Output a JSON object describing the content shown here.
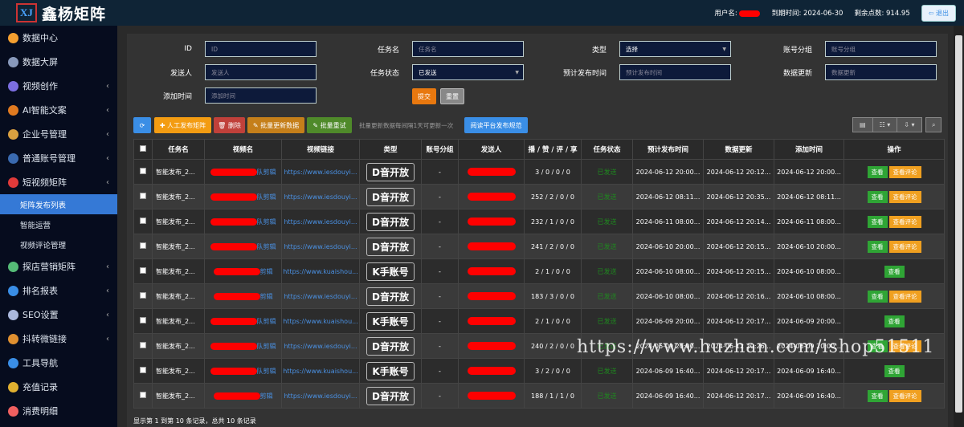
{
  "header": {
    "logo_mark": "XJ",
    "title": "鑫杨矩阵",
    "user_label": "用户名:",
    "expire": "到期时间: 2024-06-30",
    "points": "剩余点数: 914.95",
    "logout": "⇦ 退出"
  },
  "sidebar": {
    "items": [
      {
        "label": "数据中心",
        "color": "#f5a030",
        "chev": false
      },
      {
        "label": "数据大屏",
        "color": "#8899bb",
        "chev": false
      },
      {
        "label": "视频创作",
        "color": "#7b6ee0",
        "chev": true
      },
      {
        "label": "AI智能文案",
        "color": "#e07a20",
        "chev": true
      },
      {
        "label": "企业号管理",
        "color": "#d9a040",
        "chev": true
      },
      {
        "label": "普通账号管理",
        "color": "#3a6ab0",
        "chev": true
      },
      {
        "label": "短视频矩阵",
        "color": "#e03a3a",
        "chev": true
      }
    ],
    "sub": [
      "矩阵发布列表",
      "智能运营",
      "视频评论管理"
    ],
    "items2": [
      {
        "label": "探店营销矩阵",
        "color": "#55bb77",
        "chev": true
      },
      {
        "label": "排名报表",
        "color": "#3a8ee6",
        "chev": true
      },
      {
        "label": "SEO设置",
        "color": "#aab8dd",
        "chev": true
      },
      {
        "label": "抖转微链接",
        "color": "#e09030",
        "chev": true
      },
      {
        "label": "工具导航",
        "color": "#3a8ee6",
        "chev": false
      },
      {
        "label": "充值记录",
        "color": "#e0b030",
        "chev": false
      },
      {
        "label": "消费明细",
        "color": "#f06060",
        "chev": false
      }
    ]
  },
  "filters": {
    "id": {
      "label": "ID",
      "ph": "ID"
    },
    "task": {
      "label": "任务名",
      "ph": "任务名"
    },
    "type": {
      "label": "类型",
      "value": "选择"
    },
    "group": {
      "label": "账号分组",
      "ph": "账号分组"
    },
    "sender": {
      "label": "发送人",
      "ph": "发送人"
    },
    "status": {
      "label": "任务状态",
      "value": "已发送"
    },
    "plan": {
      "label": "预计发布时间",
      "ph": "预计发布时间"
    },
    "update": {
      "label": "数据更新",
      "ph": "数据更新"
    },
    "added": {
      "label": "添加时间",
      "ph": "添加时间"
    },
    "submit": "提交",
    "reset": "重置"
  },
  "toolbar": {
    "refresh": "⟳",
    "manual": "✚ 人工发布矩阵",
    "delete": "🗑 删除",
    "batch_update": "✎ 批量更新数据",
    "batch_retry": "✎ 批量重试",
    "note": "批量更新数据每间隔1天可更新一次",
    "rules": "阅读平台发布规范",
    "icons": [
      "▤",
      "☷ ▾",
      "⇩ ▾"
    ],
    "search": "⌕"
  },
  "table": {
    "headers": [
      "任务名",
      "视频名",
      "视频链接",
      "类型",
      "账号分组",
      "发送人",
      "播 / 赞 / 评 / 享",
      "任务状态",
      "预计发布时间",
      "数据更新",
      "添加时间",
      "操作"
    ],
    "view": "查看",
    "comments": "查看评论",
    "rows": [
      {
        "task": "智能发布_2...",
        "vname": "队剪辑",
        "link": "https://www.iesdouyi...",
        "type": "D音开放",
        "group": "-",
        "stats": "3 / 0 / 0 / 0",
        "status": "已发送",
        "plan": "2024-06-12 20:00...",
        "upd": "2024-06-12 20:12...",
        "add": "2024-06-12 20:00...",
        "cm": true
      },
      {
        "task": "智能发布_2...",
        "vname": "队剪辑",
        "link": "https://www.iesdouyi...",
        "type": "D音开放",
        "group": "-",
        "stats": "252 / 2 / 0 / 0",
        "status": "已发送",
        "plan": "2024-06-12 08:11...",
        "upd": "2024-06-12 20:35...",
        "add": "2024-06-12 08:11...",
        "cm": true
      },
      {
        "task": "智能发布_2...",
        "vname": "队剪辑",
        "link": "https://www.iesdouyi...",
        "type": "D音开放",
        "group": "-",
        "stats": "232 / 1 / 0 / 0",
        "status": "已发送",
        "plan": "2024-06-11 08:00...",
        "upd": "2024-06-12 20:14...",
        "add": "2024-06-11 08:00...",
        "cm": true
      },
      {
        "task": "智能发布_2...",
        "vname": "队剪辑",
        "link": "https://www.iesdouyi...",
        "type": "D音开放",
        "group": "-",
        "stats": "241 / 2 / 0 / 0",
        "status": "已发送",
        "plan": "2024-06-10 20:00...",
        "upd": "2024-06-12 20:15...",
        "add": "2024-06-10 20:00...",
        "cm": true
      },
      {
        "task": "智能发布_2...",
        "vname": "剪辑",
        "link": "https://www.kuaishou...",
        "type": "K手账号",
        "group": "-",
        "stats": "2 / 1 / 0 / 0",
        "status": "已发送",
        "plan": "2024-06-10 08:00...",
        "upd": "2024-06-12 20:15...",
        "add": "2024-06-10 08:00...",
        "cm": false
      },
      {
        "task": "智能发布_2...",
        "vname": "剪辑",
        "link": "https://www.iesdouyi...",
        "type": "D音开放",
        "group": "-",
        "stats": "183 / 3 / 0 / 0",
        "status": "已发送",
        "plan": "2024-06-10 08:00...",
        "upd": "2024-06-12 20:16...",
        "add": "2024-06-10 08:00...",
        "cm": true
      },
      {
        "task": "智能发布_2...",
        "vname": "队剪辑",
        "link": "https://www.kuaishou...",
        "type": "K手账号",
        "group": "-",
        "stats": "2 / 1 / 0 / 0",
        "status": "已发送",
        "plan": "2024-06-09 20:00...",
        "upd": "2024-06-12 20:17...",
        "add": "2024-06-09 20:00...",
        "cm": false
      },
      {
        "task": "智能发布_2...",
        "vname": "队剪辑",
        "link": "https://www.iesdouyi...",
        "type": "D音开放",
        "group": "-",
        "stats": "240 / 2 / 0 / 0",
        "status": "已发送",
        "plan": "2024-06-09 20:00...",
        "upd": "2024-06-12 20:26...",
        "add": "2024-06-09 20:00...",
        "cm": true
      },
      {
        "task": "智能发布_2...",
        "vname": "队剪辑",
        "link": "https://www.kuaishou...",
        "type": "K手账号",
        "group": "-",
        "stats": "3 / 2 / 0 / 0",
        "status": "已发送",
        "plan": "2024-06-09 16:40...",
        "upd": "2024-06-12 20:17...",
        "add": "2024-06-09 16:40...",
        "cm": false
      },
      {
        "task": "智能发布_2...",
        "vname": "剪辑",
        "link": "https://www.iesdouyi...",
        "type": "D音开放",
        "group": "-",
        "stats": "188 / 1 / 1 / 0",
        "status": "已发送",
        "plan": "2024-06-09 16:40...",
        "upd": "2024-06-12 20:17...",
        "add": "2024-06-09 16:40...",
        "cm": true
      }
    ]
  },
  "footer": "显示第 1 到第 10 条记录，总共 10 条记录",
  "watermark": "https://www.huzhan.com/ishop51511"
}
